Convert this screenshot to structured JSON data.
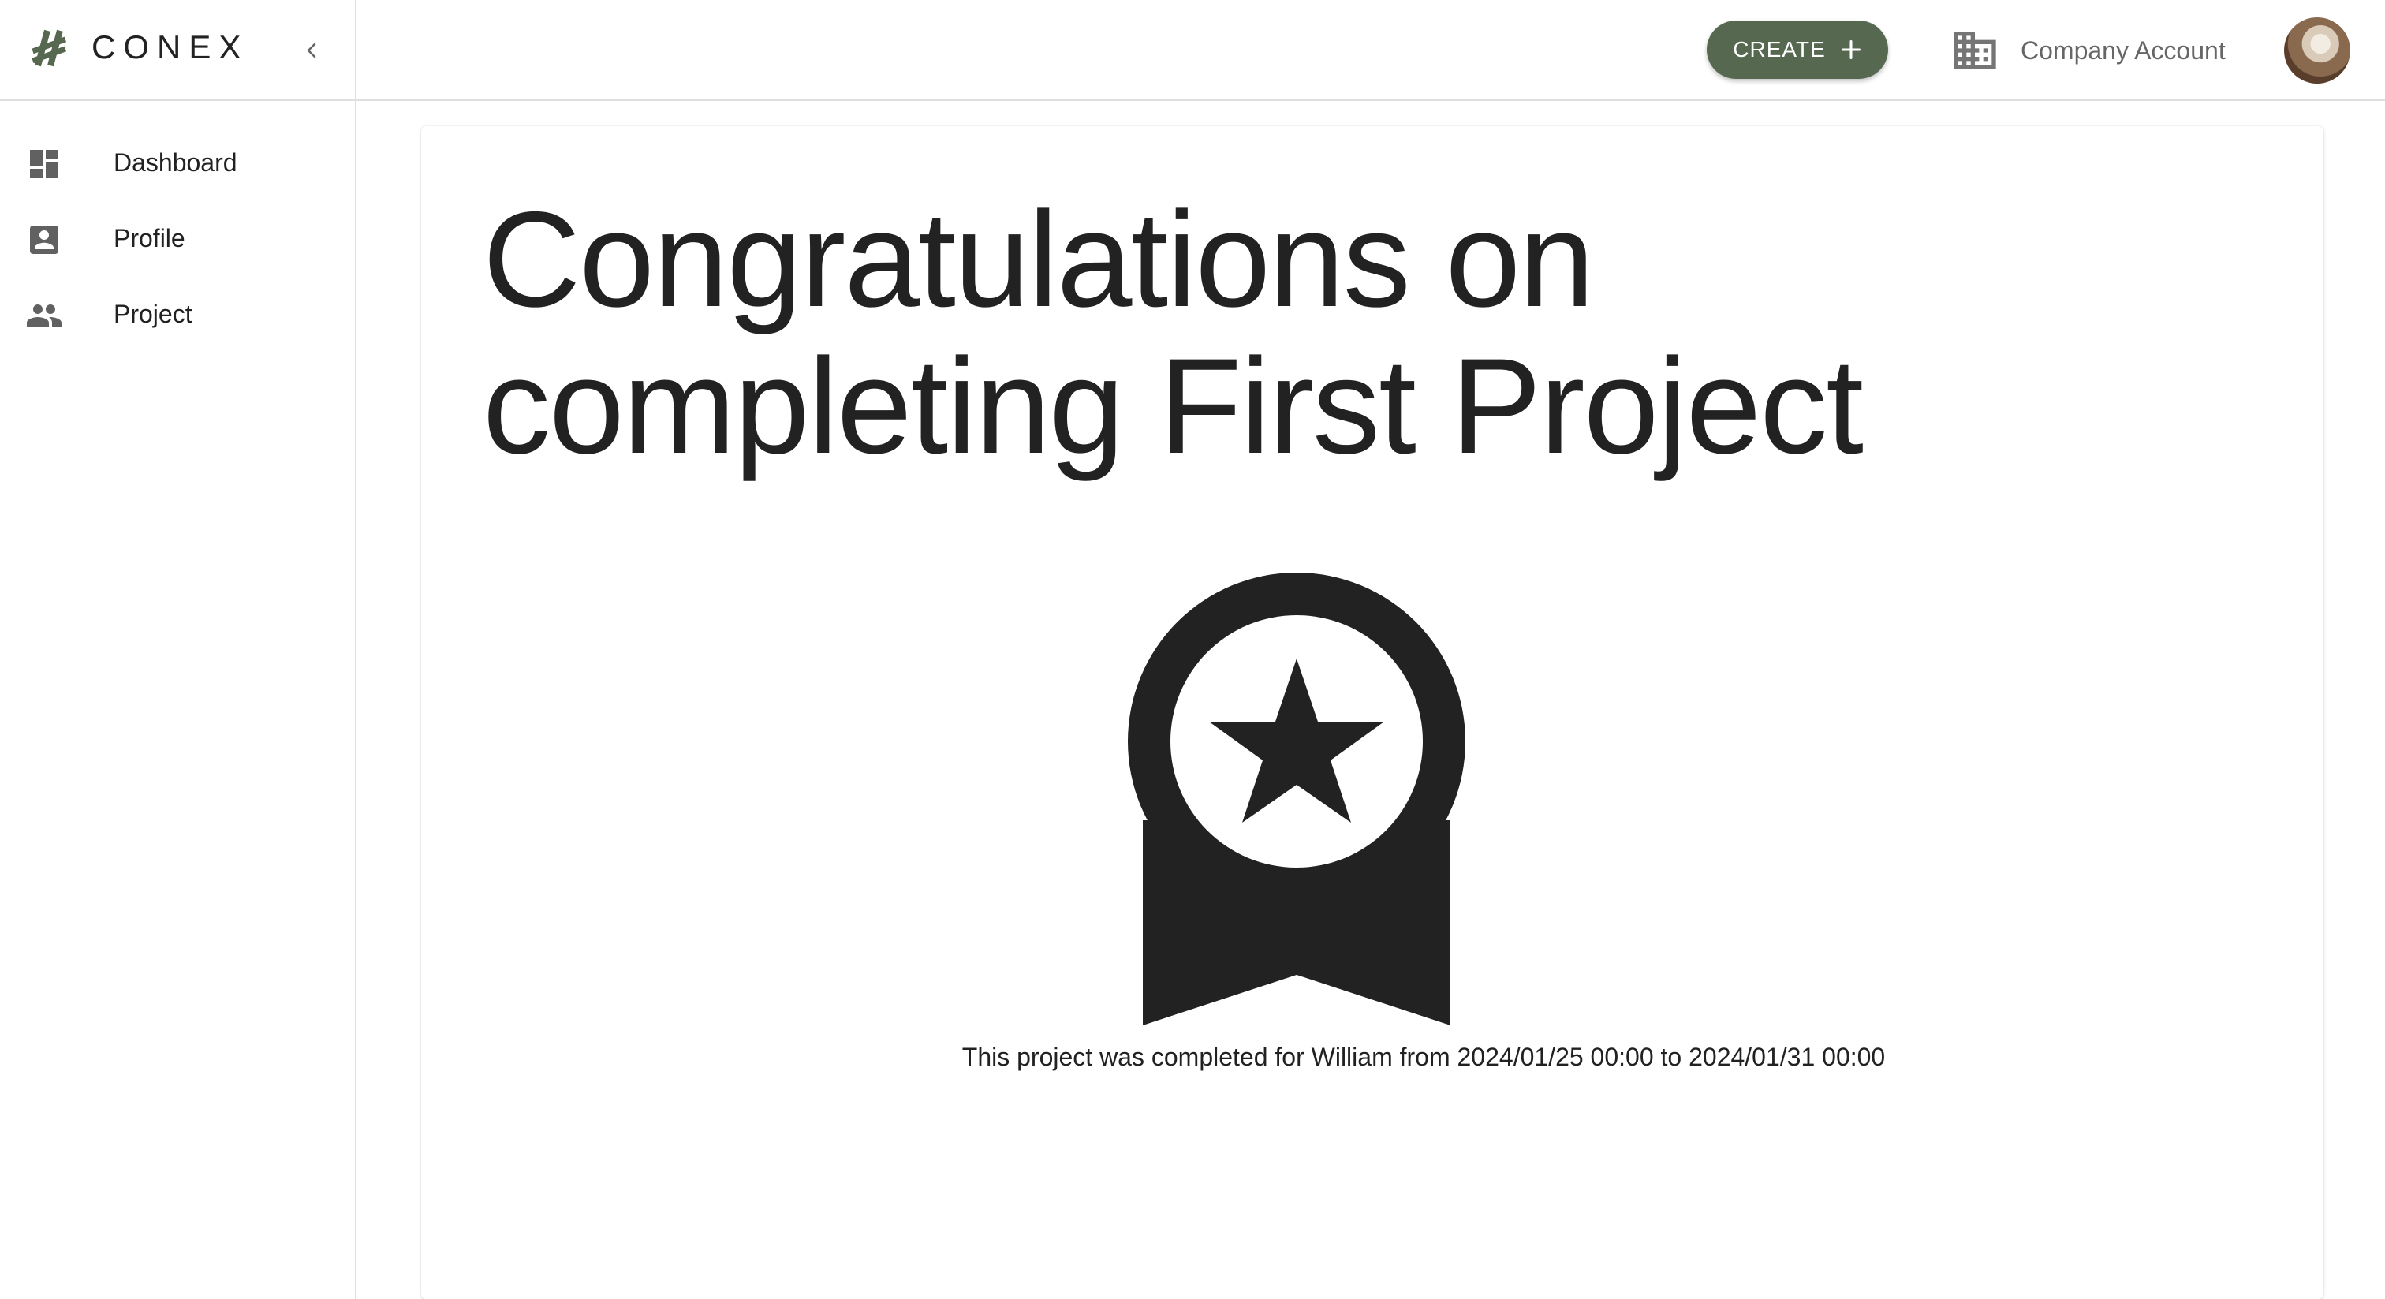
{
  "brand": {
    "name": "CONEX",
    "logo_icon": "conex-logo-icon",
    "accent": "#56684f"
  },
  "sidebar": {
    "collapse_icon": "chevron-left-icon",
    "items": [
      {
        "label": "Dashboard",
        "icon": "dashboard-icon"
      },
      {
        "label": "Profile",
        "icon": "account-box-icon"
      },
      {
        "label": "Project",
        "icon": "people-icon"
      }
    ]
  },
  "header": {
    "create_label": "CREATE",
    "create_icon": "plus-icon",
    "company_label": "Company Account",
    "company_icon": "building-icon",
    "avatar_icon": "user-avatar"
  },
  "main": {
    "headline": "Congratulations on completing First Project",
    "award_icon": "award-ribbon-star-icon",
    "completion_text": "This project was completed for William from 2024/01/25 00:00 to 2024/01/31 00:00"
  }
}
